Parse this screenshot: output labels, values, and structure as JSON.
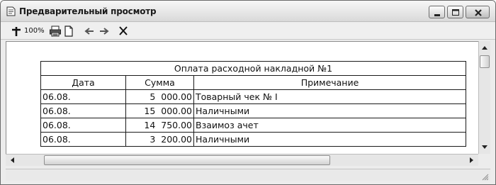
{
  "window": {
    "title": "Предварительный просмотр"
  },
  "toolbar": {
    "zoom_label": "100%"
  },
  "report": {
    "caption": "Оплата расходной накладной №1",
    "columns": [
      "Дата",
      "Сумма",
      "Примечание"
    ],
    "rows": [
      {
        "date": "06.08.",
        "amount": "5  000.00",
        "note": "Товарный чек № I"
      },
      {
        "date": "06.08.",
        "amount": "15  000.00",
        "note": "Наличными"
      },
      {
        "date": "06.08.",
        "amount": "14  750.00",
        "note": "Взаимоз ачет"
      },
      {
        "date": "06.08.",
        "amount": "3  200.00",
        "note": "Наличными"
      }
    ]
  },
  "icons": {
    "app": "document-icon",
    "zoom": "zoom-cross-icon",
    "print": "printer-icon",
    "page": "page-icon",
    "back": "arrow-left-icon",
    "forward": "arrow-right-icon",
    "close": "close-icon"
  }
}
